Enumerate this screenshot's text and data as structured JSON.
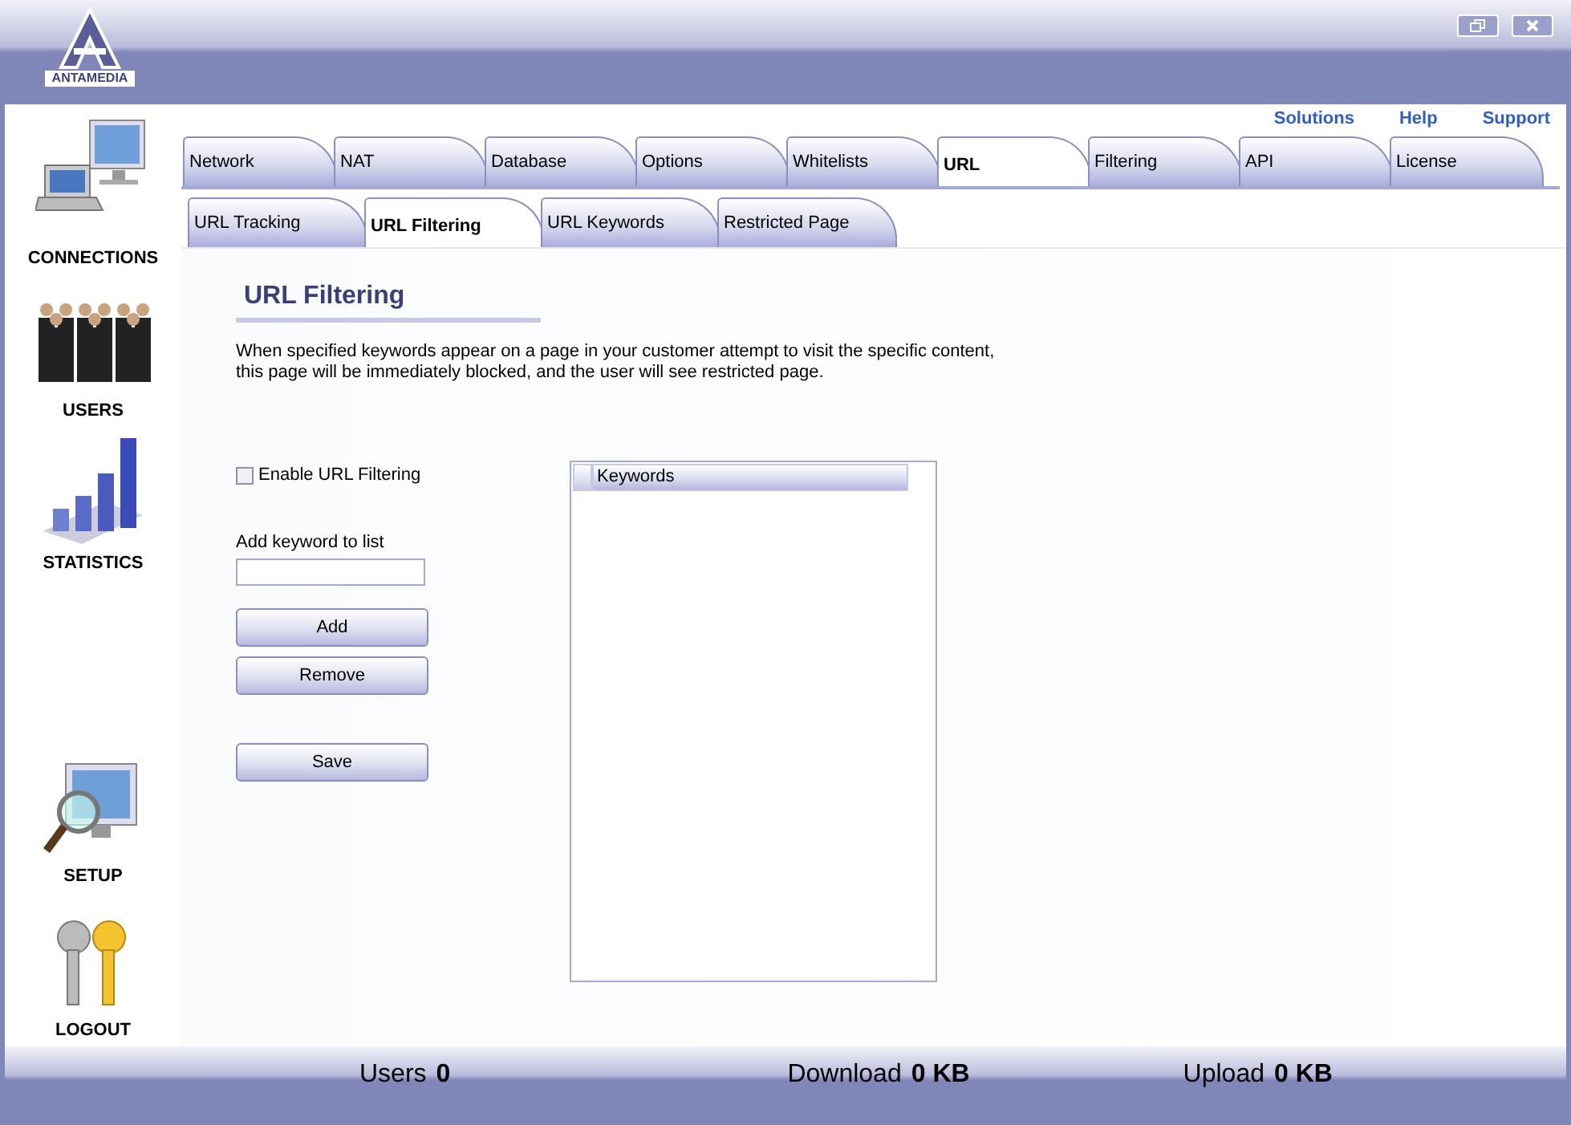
{
  "logo": {
    "text": "ANTAMEDIA"
  },
  "sidebar": {
    "items": [
      {
        "label": "CONNECTIONS",
        "kind": "connections"
      },
      {
        "label": "USERS",
        "kind": "users"
      },
      {
        "label": "STATISTICS",
        "kind": "statistics"
      },
      {
        "label": "SETUP",
        "kind": "setup"
      },
      {
        "label": "LOGOUT",
        "kind": "logout"
      }
    ]
  },
  "top_links": [
    "Solutions",
    "Help",
    "Support"
  ],
  "tabs": [
    {
      "label": "Network",
      "selected": false
    },
    {
      "label": "NAT",
      "selected": false
    },
    {
      "label": "Database",
      "selected": false
    },
    {
      "label": "Options",
      "selected": false
    },
    {
      "label": "Whitelists",
      "selected": false
    },
    {
      "label": "URL",
      "selected": true
    },
    {
      "label": "Filtering",
      "selected": false
    },
    {
      "label": "API",
      "selected": false
    },
    {
      "label": "License",
      "selected": false
    }
  ],
  "subtabs": [
    {
      "label": "URL Tracking",
      "selected": false
    },
    {
      "label": "URL Filtering",
      "selected": true
    },
    {
      "label": "URL Keywords",
      "selected": false
    },
    {
      "label": "Restricted Page",
      "selected": false
    }
  ],
  "content": {
    "heading": "URL Filtering",
    "description": "When specified keywords appear on a page in your customer attempt to visit the specific content, this page will be immediately blocked, and the user will see restricted page.",
    "enable_checkbox": {
      "label": "Enable URL Filtering",
      "checked": false
    },
    "keyword_field": {
      "label": "Add keyword to list"
    },
    "buttons": [
      "Add",
      "Remove"
    ],
    "save_button": "Save",
    "keywords_list": {
      "columns": [
        "Keywords"
      ]
    }
  },
  "status_bar": [
    {
      "label": "Users",
      "value": "0"
    },
    {
      "label": "Download",
      "value": "0 KB"
    },
    {
      "label": "Upload",
      "value": "0 KB"
    }
  ]
}
